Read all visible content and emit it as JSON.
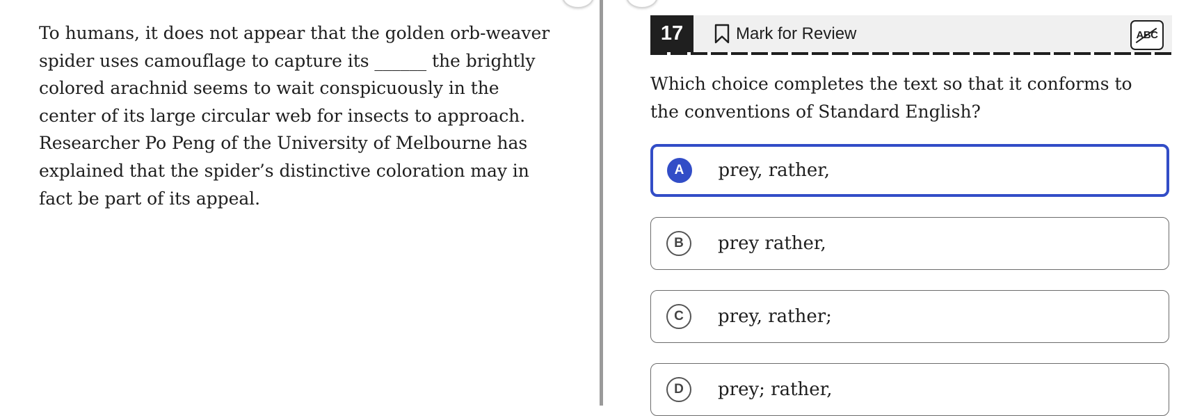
{
  "passage": {
    "text": "To humans, it does not appear that the golden orb-weaver spider uses camouflage to capture its ______ the brightly colored arachnid seems to wait conspicuously in the center of its large circular web for insects to approach. Researcher Po Peng of the University of Melbourne has explained that the spider’s distinctive coloration may in fact be part of its appeal."
  },
  "question": {
    "number": "17",
    "mark_for_review_label": "Mark for Review",
    "abc_tool_label": "ABC",
    "prompt": "Which choice completes the text so that it conforms to the conventions of Standard English?",
    "selected": "A",
    "choices": [
      {
        "letter": "A",
        "text": "prey, rather,"
      },
      {
        "letter": "B",
        "text": "prey rather,"
      },
      {
        "letter": "C",
        "text": "prey, rather;"
      },
      {
        "letter": "D",
        "text": "prey; rather,"
      }
    ]
  },
  "colors": {
    "selected_accent": "#324dc7",
    "header_bg": "#f0f0f0",
    "number_bg": "#1f1f1f"
  }
}
